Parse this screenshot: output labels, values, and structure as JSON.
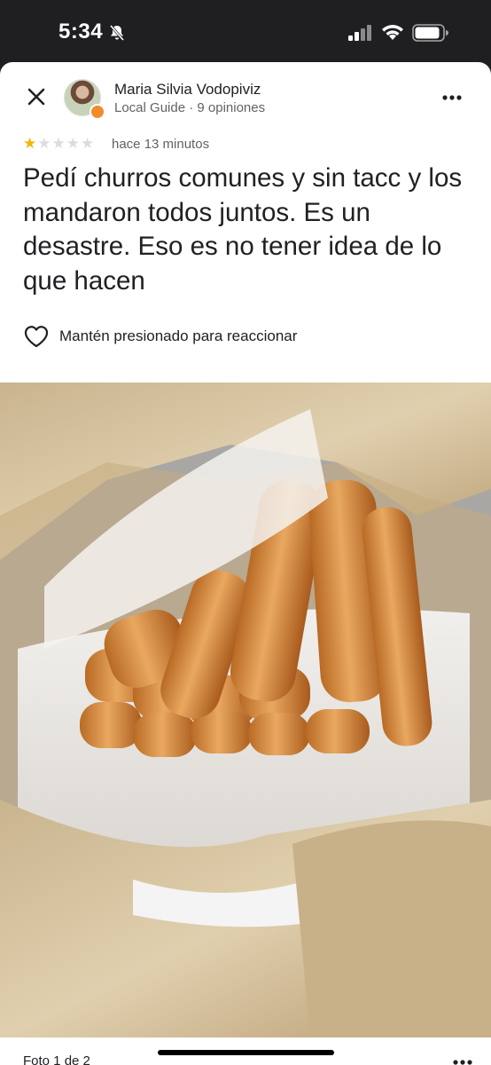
{
  "status_bar": {
    "time": "5:34",
    "icons": [
      "bell-slash-icon",
      "signal-icon",
      "wifi-icon",
      "battery-icon"
    ]
  },
  "reviewer": {
    "name": "Maria Silvia Vodopiviz",
    "meta": "Local Guide · 9 opiniones",
    "badge_color": "#f28b2b"
  },
  "review": {
    "rating": 1,
    "max_rating": 5,
    "time_ago": "hace 13 minutos",
    "text": "Pedí churros comunes y sin tacc y los mandaron todos juntos. Es un desastre. Eso es no tener idea de lo que hacen"
  },
  "reaction": {
    "label": "Mantén presionado para reaccionar",
    "icon": "heart-outline-icon"
  },
  "photo": {
    "counter": "Foto 1 de 2"
  },
  "colors": {
    "star_on": "#f4b400",
    "star_off": "#dadce0",
    "text_primary": "#202124",
    "text_secondary": "#5f6368"
  }
}
